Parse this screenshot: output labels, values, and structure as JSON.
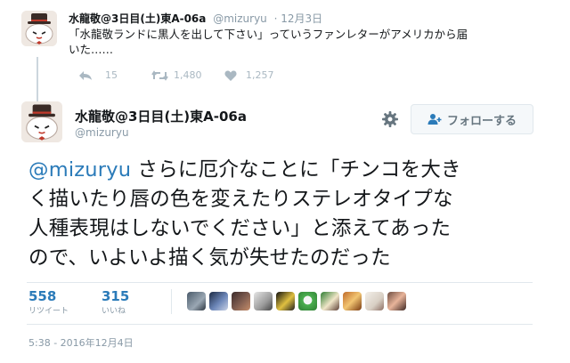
{
  "reply_tweet": {
    "name": "水龍敬@3日目(土)東A-06a",
    "handle": "@mizuryu",
    "date": "· 12月3日",
    "text_line1": "「水龍敬ランドに黒人を出して下さい」っていうファンレターがアメリカから届",
    "text_line2": "いた……",
    "replies": "15",
    "retweets": "1,480",
    "likes": "1,257"
  },
  "main_tweet": {
    "name": "水龍敬@3日目(土)東A-06a",
    "handle": "@mizuryu",
    "follow_label": "フォローする",
    "mention": "@mizuryu",
    "text_line1": " さらに厄介なことに「チンコを大き",
    "text_line2": "く描いたり唇の色を変えたりステレオタイプな",
    "text_line3": "人種表現はしないでください」と添えてあった",
    "text_line4": "ので、いよいよ描く気が失せたのだった",
    "retweets_count": "558",
    "retweets_label": "リツイート",
    "likes_count": "315",
    "likes_label": "いいね",
    "timestamp": "5:38 - 2016年12月4日"
  },
  "colors": {
    "accent": "#2b7bb9",
    "muted": "#8899a6",
    "retweet_green": "#aab8c2",
    "divider": "#e1e8ed"
  },
  "icons": [
    "reply-icon",
    "retweet-icon",
    "heart-icon",
    "gear-icon",
    "person-add-icon"
  ]
}
